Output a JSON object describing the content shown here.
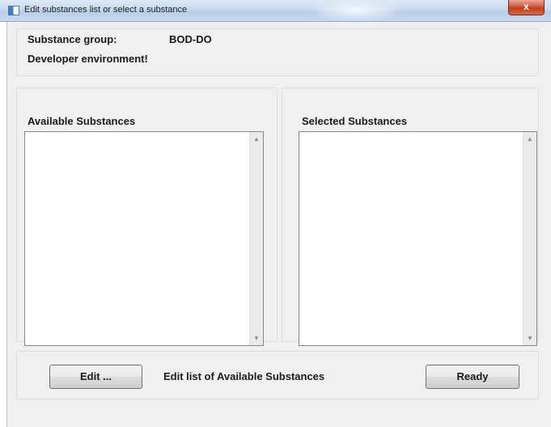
{
  "window": {
    "title": "Edit substances list or select a substance",
    "close_glyph": "x"
  },
  "info": {
    "group_label": "Substance group:",
    "group_value": "BOD-DO",
    "environment_note": "Developer environment!"
  },
  "available": {
    "header": "Available Substances",
    "items": []
  },
  "selected": {
    "header": "Selected Substances",
    "items": []
  },
  "scroll": {
    "up_glyph": "▲",
    "down_glyph": "▼"
  },
  "footer": {
    "edit_label": "Edit ...",
    "edit_hint": "Edit list of Available Substances",
    "ready_label": "Ready"
  },
  "icons": {
    "app": "app-window-icon",
    "close": "close-icon"
  }
}
